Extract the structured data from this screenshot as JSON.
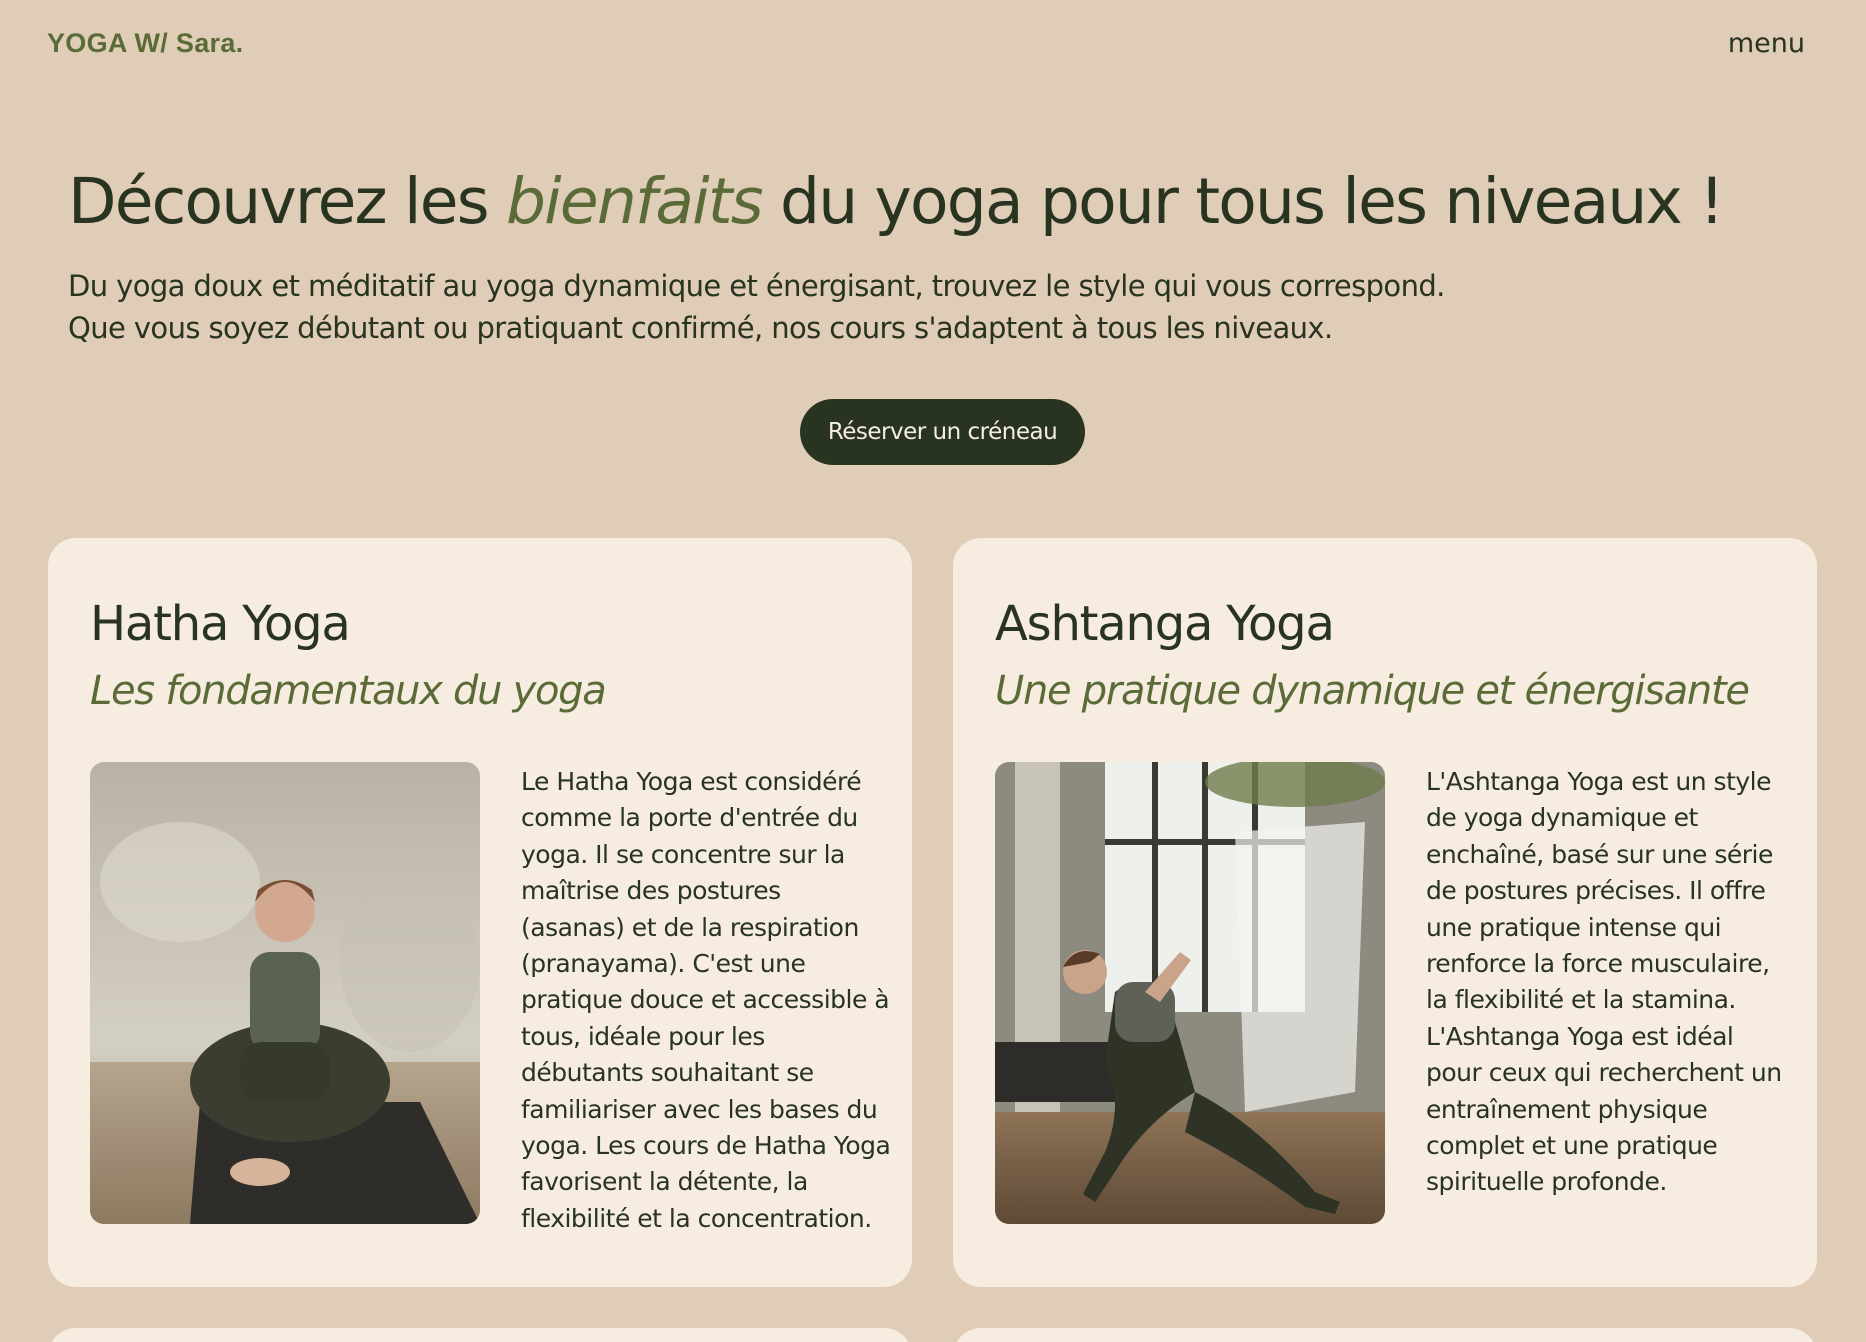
{
  "nav": {
    "logo": "YOGA W/ Sara.",
    "menu_label": "menu"
  },
  "hero": {
    "title_before": "Découvrez les",
    "title_emphasis": "bienfaits",
    "title_after": "du yoga pour tous les niveaux !",
    "subtitle_line1": "Du yoga doux et méditatif au yoga dynamique et énergisant, trouvez le style qui vous correspond.",
    "subtitle_line2": "Que vous soyez débutant ou pratiquant confirmé, nos cours s'adaptent à tous les niveaux.",
    "cta_label": "Réserver un créneau"
  },
  "cards": [
    {
      "title": "Hatha Yoga",
      "tagline": "Les fondamentaux du yoga",
      "description": "Le Hatha Yoga est considéré comme la porte d'entrée du yoga. Il se concentre sur la maîtrise des postures (asanas) et de la respiration (pranayama). C'est une pratique douce et accessible à tous, idéale pour les débutants souhaitant se familiariser avec les bases du yoga. Les cours de Hatha Yoga favorisent la détente, la flexibilité et la concentration."
    },
    {
      "title": "Ashtanga Yoga",
      "tagline": "Une pratique dynamique et énergisante",
      "description": "L'Ashtanga Yoga est un style de yoga dynamique et enchaîné, basé sur une série de postures précises. Il offre une pratique intense qui renforce la force musculaire, la flexibilité et la stamina. L'Ashtanga Yoga est idéal pour ceux qui recherchent un entraînement physique complet et une pratique spirituelle profonde."
    }
  ],
  "colors": {
    "background": "#e0cdb7",
    "card": "#f6ece0",
    "dark_green": "#283320",
    "accent_green": "#5b6b38"
  }
}
